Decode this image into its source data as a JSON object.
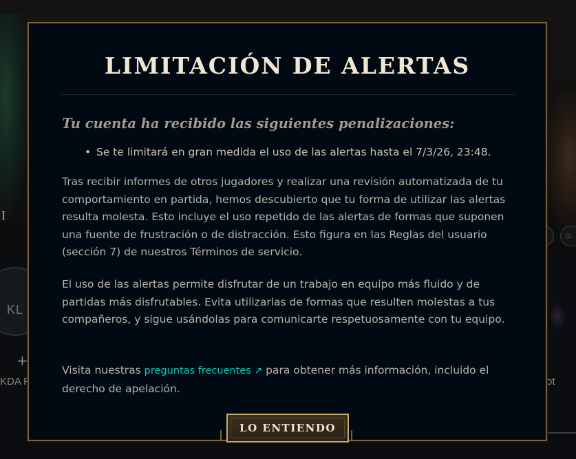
{
  "dialog": {
    "title": "LIMITACIÓN DE ALERTAS",
    "subtitle": "Tu cuenta ha recibido las siguientes penalizaciones:",
    "penalties": [
      "Se te limitará en gran medida el uso de las alertas hasta el 7/3/26, 23:48."
    ],
    "paragraph1": "Tras recibir informes de otros jugadores y realizar una revisión automatizada de tu comportamiento en partida, hemos descubierto que tu forma de utilizar las alertas resulta molesta. Esto incluye el uso repetido de las alertas de formas que suponen una fuente de frustración o de distracción. Esto figura en las Reglas del usuario (sección 7) de nuestros Términos de servicio.",
    "paragraph2": "El uso de las alertas permite disfrutar de un trabajo en equipo más fluido y de partidas más disfrutables. Evita utilizarlas de formas que resulten molestas a tus compañeros, y sigue usándolas para comunicarte respetuosamente con tu equipo.",
    "paragraph3_before": "Visita nuestras ",
    "faq_link_label": "preguntas frecuentes",
    "faq_link_icon": "↗",
    "paragraph3_after": " para obtener más información, incluido el derecho de apelación.",
    "ok_button_label": "LO ENTIENDO"
  },
  "background": {
    "left_label": "I",
    "plus_icon": "+",
    "kda_label": "KDA F",
    "right_label": "ot",
    "left_logo": "KL"
  },
  "colors": {
    "dialog_bg": "#010a13",
    "gold_border": "#7a6236",
    "title": "#f0e6d2",
    "link": "#0ac8b9"
  }
}
